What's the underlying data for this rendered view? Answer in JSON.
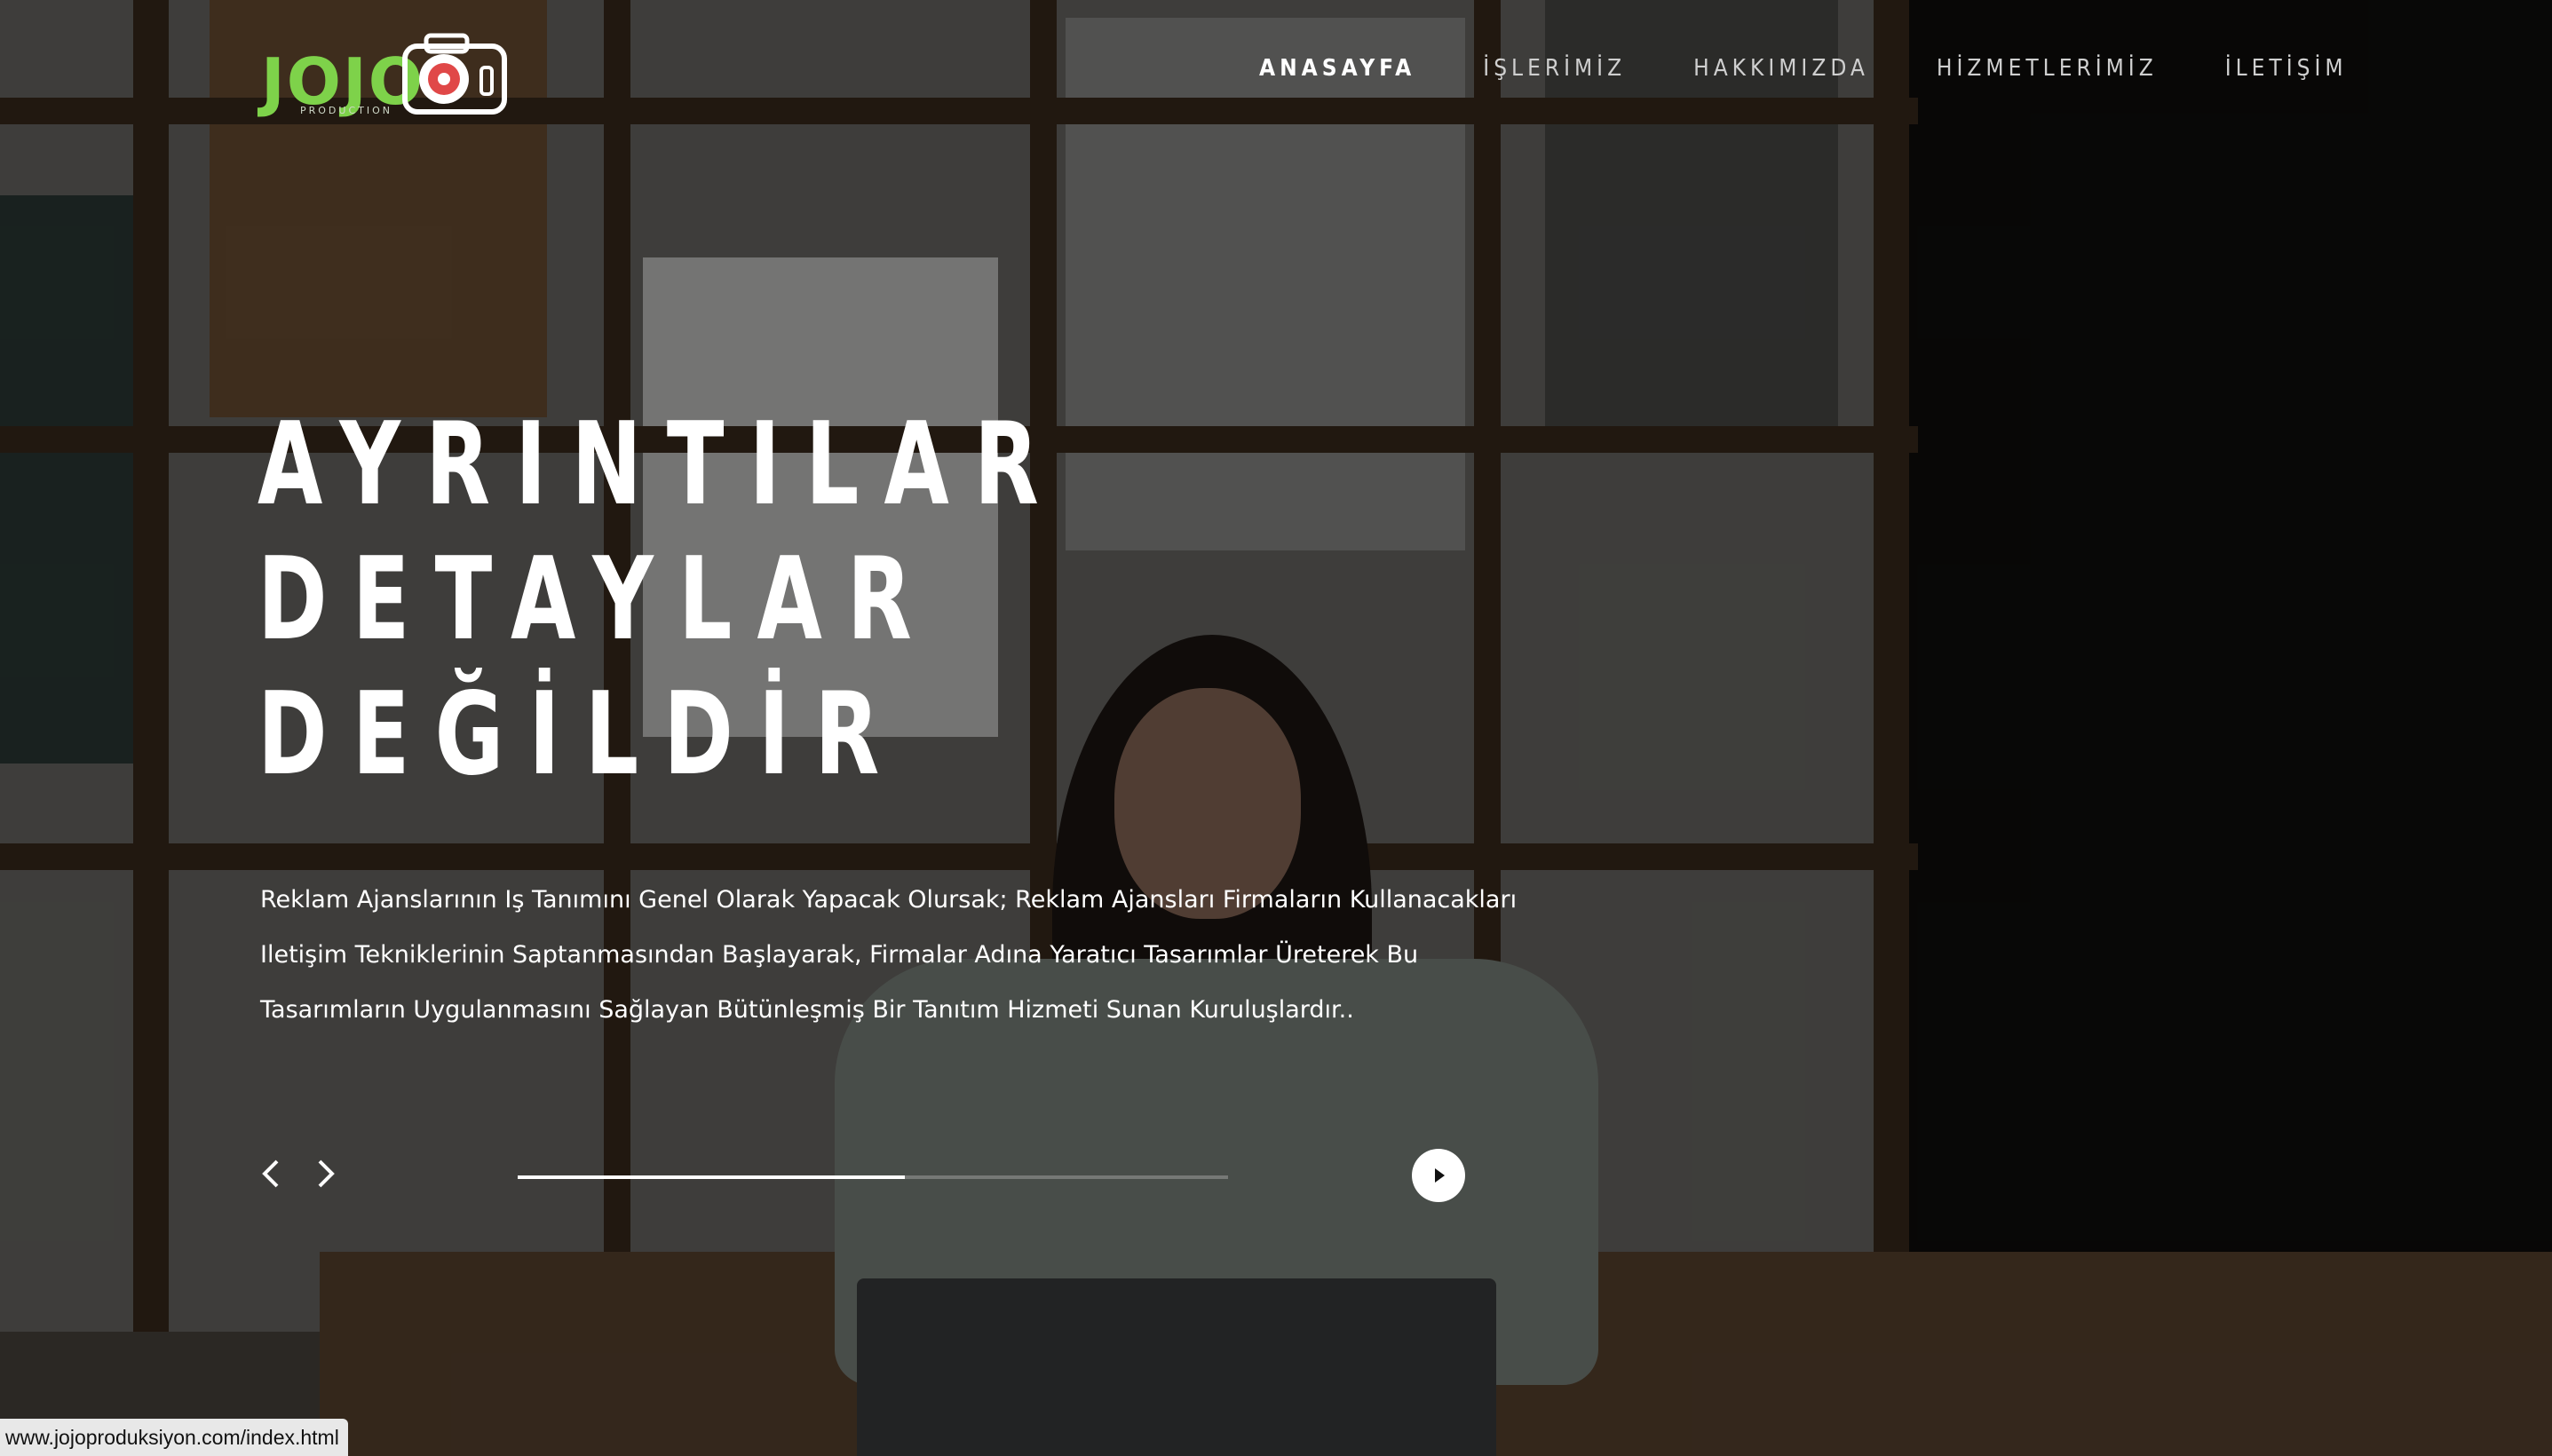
{
  "brand": {
    "logo_text": "JOJO",
    "logo_sub": "PRODUCTION"
  },
  "nav": {
    "items": [
      {
        "label": "ANASAYFA",
        "active": true
      },
      {
        "label": "İŞLERİMİZ",
        "active": false
      },
      {
        "label": "HAKKIMIZDA",
        "active": false
      },
      {
        "label": "HİZMETLERİMİZ",
        "active": false
      },
      {
        "label": "İLETİŞİM",
        "active": false
      }
    ]
  },
  "hero": {
    "headline": [
      "AYRINTILAR",
      "DETAYLAR",
      "DEĞİLDİR"
    ],
    "paragraph_lines": [
      "Reklam Ajanslarının Iş Tanımını Genel Olarak Yapacak Olursak; Reklam Ajansları Firmaların Kullanacakları",
      "Iletişim Tekniklerinin Saptanmasından Başlayarak, Firmalar Adına Yaratıcı Tasarımlar Üreterek Bu",
      "Tasarımların Uygulanmasını Sağlayan Bütünleşmiş Bir Tanıtım Hizmeti Sunan Kuruluşlardır.."
    ]
  },
  "slider": {
    "prev_icon": "‹",
    "next_icon": "›",
    "progress": 0.545
  },
  "status_url": "www.jojoproduksiyon.com/index.html",
  "colors": {
    "logo_green": "#7ed24a",
    "text": "#ffffff"
  }
}
